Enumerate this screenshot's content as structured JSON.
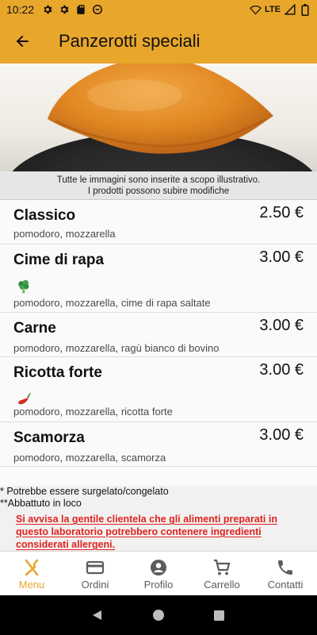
{
  "status_bar": {
    "time": "10:22",
    "network": "LTE"
  },
  "app_bar": {
    "title": "Panzerotti speciali"
  },
  "hero": {
    "disclaimer_line1": "Tutte le immagini sono inserite a scopo illustrativo.",
    "disclaimer_line2": "I prodotti possono subire modifiche"
  },
  "menu": {
    "items": [
      {
        "name": "Classico",
        "price": "2.50 €",
        "description": "pomodoro, mozzarella",
        "icon": ""
      },
      {
        "name": "Cime di rapa",
        "price": "3.00 €",
        "description": "pomodoro, mozzarella, cime di rapa saltate",
        "icon": "broccoli-icon"
      },
      {
        "name": "Carne",
        "price": "3.00 €",
        "description": "pomodoro, mozzarella, ragù bianco di bovino",
        "icon": ""
      },
      {
        "name": "Ricotta forte",
        "price": "3.00 €",
        "description": "pomodoro, mozzarella, ricotta forte",
        "icon": "chili-pepper-icon"
      },
      {
        "name": "Scamorza",
        "price": "3.00 €",
        "description": "pomodoro, mozzarella, scamorza",
        "icon": ""
      }
    ]
  },
  "footnotes": {
    "frozen_note": "* Potrebbe essere surgelato/congelato",
    "chilled_note": "**Abbattuto in loco",
    "allergen_warning": "Si avvisa la gentile clientela che gli alimenti preparati in questo laboratorio potrebbero contenere ingredienti considerati allergeni."
  },
  "bottom_nav": {
    "items": [
      {
        "label": "Menu",
        "icon": "utensils-icon",
        "active": true
      },
      {
        "label": "Ordini",
        "icon": "card-icon",
        "active": false
      },
      {
        "label": "Profilo",
        "icon": "account-icon",
        "active": false
      },
      {
        "label": "Carrello",
        "icon": "cart-icon",
        "active": false
      },
      {
        "label": "Contatti",
        "icon": "phone-icon",
        "active": false
      }
    ]
  },
  "colors": {
    "accent": "#e8a62b",
    "warning": "#e0231e",
    "active_nav": "#e8a62b",
    "background": "#fafafa"
  }
}
